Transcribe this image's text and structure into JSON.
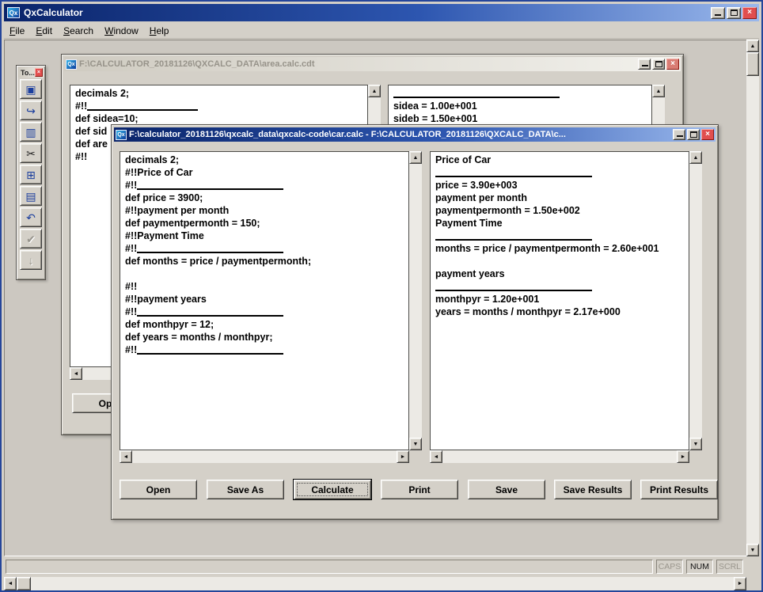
{
  "main_window": {
    "title": "QxCalculator",
    "logo": "Qx",
    "menu": [
      "File",
      "Edit",
      "Search",
      "Window",
      "Help"
    ]
  },
  "toolbox": {
    "title": "To...",
    "icons": [
      {
        "name": "app-tool-icon",
        "glyph": "▣"
      },
      {
        "name": "open-icon",
        "glyph": "↪"
      },
      {
        "name": "copy-icon",
        "glyph": "▥"
      },
      {
        "name": "cut-icon",
        "glyph": "✂"
      },
      {
        "name": "paste-icon",
        "glyph": "⊞"
      },
      {
        "name": "notes-icon",
        "glyph": "▤"
      },
      {
        "name": "undo-icon",
        "glyph": "↶"
      },
      {
        "name": "apply-icon",
        "glyph": "✔"
      },
      {
        "name": "down-icon",
        "glyph": "↓"
      }
    ]
  },
  "background_window": {
    "title": "F:\\CALCULATOR_20181126\\QXCALC_DATA\\area.calc.cdt",
    "open_button": "Open",
    "code_lines": [
      {
        "t": "decimals 2;"
      },
      {
        "t": "#!!",
        "rule": true,
        "rw": 140
      },
      {
        "t": "def sidea=10;"
      },
      {
        "t": "def sid"
      },
      {
        "t": "def are"
      },
      {
        "t": "#!!"
      }
    ],
    "result_lines": [
      {
        "rule": true,
        "rw": 210
      },
      {
        "t": "sidea = 1.00e+001"
      },
      {
        "t": "sideb = 1.50e+001"
      }
    ]
  },
  "foreground_window": {
    "title": "F:\\calculator_20181126\\qxcalc_data\\qxcalc-code\\car.calc - F:\\CALCULATOR_20181126\\QXCALC_DATA\\c...",
    "buttons": [
      "Open",
      "Save As",
      "Calculate",
      "Print",
      "Save",
      "Save Results",
      "Print Results"
    ],
    "code_lines": [
      {
        "t": "decimals 2;"
      },
      {
        "t": "#!!Price of Car"
      },
      {
        "t": "#!!",
        "rule": true,
        "rw": 185
      },
      {
        "t": "def price = 3900;"
      },
      {
        "t": "#!!payment per month"
      },
      {
        "t": "def paymentpermonth = 150;"
      },
      {
        "t": "#!!Payment Time"
      },
      {
        "t": "#!!",
        "rule": true,
        "rw": 185
      },
      {
        "t": "def months = price / paymentpermonth;"
      },
      {
        "t": ""
      },
      {
        "t": "#!!"
      },
      {
        "t": "#!!payment years"
      },
      {
        "t": "#!!",
        "rule": true,
        "rw": 185
      },
      {
        "t": "def monthpyr = 12;"
      },
      {
        "t": "def years = months / monthpyr;"
      },
      {
        "t": "#!!",
        "rule": true,
        "rw": 185
      }
    ],
    "result_lines": [
      {
        "t": "Price of Car"
      },
      {
        "rule": true,
        "rw": 198
      },
      {
        "t": "price = 3.90e+003"
      },
      {
        "t": "payment per month"
      },
      {
        "t": "paymentpermonth = 1.50e+002"
      },
      {
        "t": "Payment Time"
      },
      {
        "rule": true,
        "rw": 198
      },
      {
        "t": "months = price / paymentpermonth = 2.60e+001"
      },
      {
        "t": ""
      },
      {
        "t": "payment years"
      },
      {
        "rule": true,
        "rw": 198
      },
      {
        "t": "monthpyr = 1.20e+001"
      },
      {
        "t": "years = months / monthpyr = 2.17e+000"
      }
    ]
  },
  "status_bar": {
    "message": "",
    "caps": "CAPS",
    "num": "NUM",
    "scrl": "SCRL"
  },
  "icons": {
    "close": "×",
    "scroll_arrows": {
      "up": "▲",
      "down": "▼",
      "left": "◄",
      "right": "►"
    }
  },
  "colors": {
    "titlebar_active_start": "#0a246a",
    "titlebar_active_end": "#9ab8ec",
    "close_red": "#e14e4e",
    "inactive_title_text": "#97938a"
  }
}
